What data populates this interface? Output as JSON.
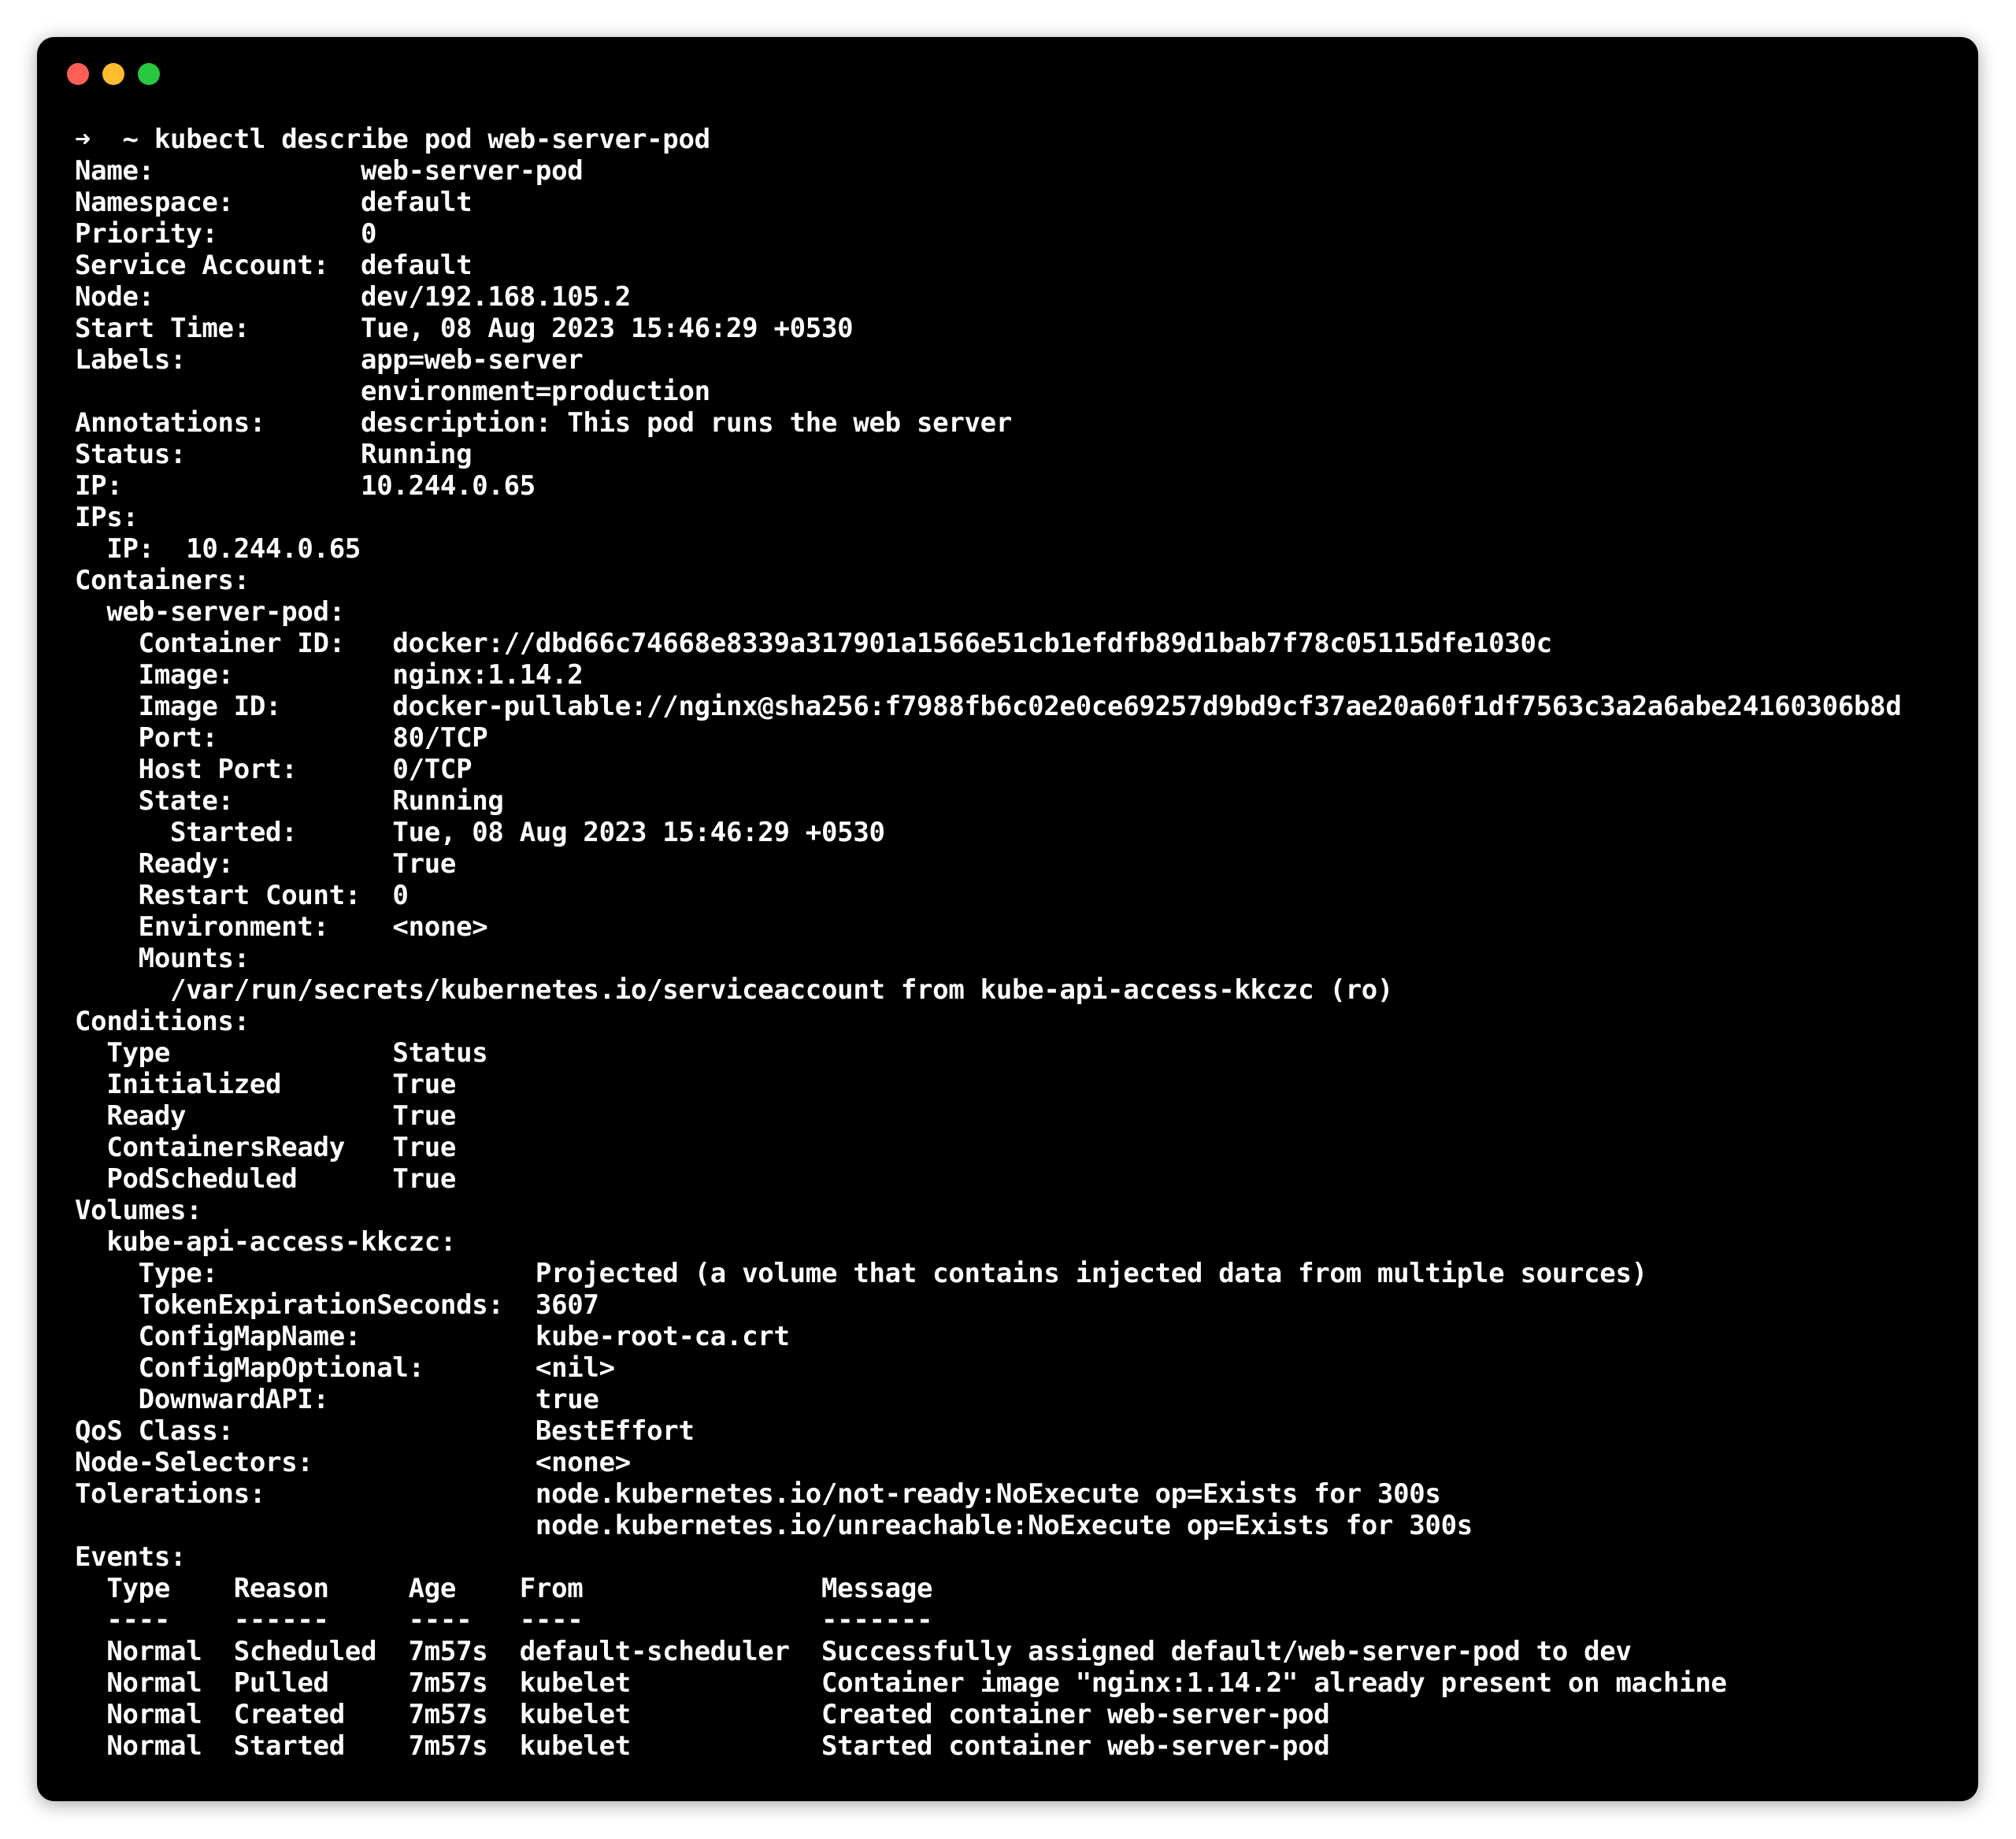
{
  "window": {
    "controls": [
      {
        "name": "close",
        "color": "#ff5f57"
      },
      {
        "name": "minimize",
        "color": "#febc2e"
      },
      {
        "name": "maximize",
        "color": "#28c840"
      }
    ]
  },
  "terminal": {
    "lines": [
      "➜  ~ kubectl describe pod web-server-pod",
      "Name:             web-server-pod",
      "Namespace:        default",
      "Priority:         0",
      "Service Account:  default",
      "Node:             dev/192.168.105.2",
      "Start Time:       Tue, 08 Aug 2023 15:46:29 +0530",
      "Labels:           app=web-server",
      "                  environment=production",
      "Annotations:      description: This pod runs the web server",
      "Status:           Running",
      "IP:               10.244.0.65",
      "IPs:",
      "  IP:  10.244.0.65",
      "Containers:",
      "  web-server-pod:",
      "    Container ID:   docker://dbd66c74668e8339a317901a1566e51cb1efdfb89d1bab7f78c05115dfe1030c",
      "    Image:          nginx:1.14.2",
      "    Image ID:       docker-pullable://nginx@sha256:f7988fb6c02e0ce69257d9bd9cf37ae20a60f1df7563c3a2a6abe24160306b8d",
      "    Port:           80/TCP",
      "    Host Port:      0/TCP",
      "    State:          Running",
      "      Started:      Tue, 08 Aug 2023 15:46:29 +0530",
      "    Ready:          True",
      "    Restart Count:  0",
      "    Environment:    <none>",
      "    Mounts:",
      "      /var/run/secrets/kubernetes.io/serviceaccount from kube-api-access-kkczc (ro)",
      "Conditions:",
      "  Type              Status",
      "  Initialized       True",
      "  Ready             True",
      "  ContainersReady   True",
      "  PodScheduled      True",
      "Volumes:",
      "  kube-api-access-kkczc:",
      "    Type:                    Projected (a volume that contains injected data from multiple sources)",
      "    TokenExpirationSeconds:  3607",
      "    ConfigMapName:           kube-root-ca.crt",
      "    ConfigMapOptional:       <nil>",
      "    DownwardAPI:             true",
      "QoS Class:                   BestEffort",
      "Node-Selectors:              <none>",
      "Tolerations:                 node.kubernetes.io/not-ready:NoExecute op=Exists for 300s",
      "                             node.kubernetes.io/unreachable:NoExecute op=Exists for 300s",
      "Events:",
      "  Type    Reason     Age    From               Message",
      "  ----    ------     ----   ----               -------",
      "  Normal  Scheduled  7m57s  default-scheduler  Successfully assigned default/web-server-pod to dev",
      "  Normal  Pulled     7m57s  kubelet            Container image \"nginx:1.14.2\" already present on machine",
      "  Normal  Created    7m57s  kubelet            Created container web-server-pod",
      "  Normal  Started    7m57s  kubelet            Started container web-server-pod"
    ]
  }
}
